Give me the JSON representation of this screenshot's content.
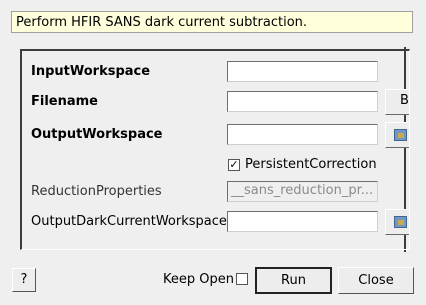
{
  "description": "Perform HFIR SANS dark current subtraction.",
  "properties": [
    {
      "label": "InputWorkspace",
      "value": ""
    },
    {
      "label": "Filename",
      "value": "",
      "browse_label": "B"
    },
    {
      "label": "OutputWorkspace",
      "value": "",
      "side_icon": "workspace-icon"
    },
    {
      "label": "PersistentCorrection",
      "checked": true,
      "check_mark": "✓"
    },
    {
      "label": "ReductionProperties",
      "value": "__sans_reduction_pr..."
    },
    {
      "label": "OutputDarkCurrentWorkspace",
      "value": "",
      "side_icon": "workspace-icon"
    }
  ],
  "footer": {
    "help_label": "?",
    "keep_open_label": "Keep Open",
    "run_label": "Run",
    "close_label": "Close"
  }
}
